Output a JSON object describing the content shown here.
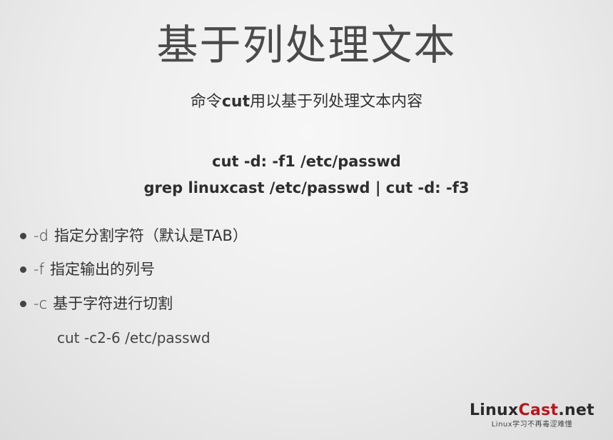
{
  "slide": {
    "title": "基于列处理文本",
    "subtitle": {
      "prefix": "命令",
      "keyword": "cut",
      "suffix": "用以基于列处理文本内容"
    },
    "commands": [
      "cut -d: -f1 /etc/passwd",
      "grep linuxcast /etc/passwd | cut -d: -f3"
    ],
    "bullets": [
      {
        "option": "-d",
        "text": "指定分割字符（默认是TAB）"
      },
      {
        "option": "-f",
        "text": "指定输出的列号"
      },
      {
        "option": "-c",
        "text": "基于字符进行切割"
      }
    ],
    "example": "cut -c2-6 /etc/passwd"
  },
  "logo": {
    "brand_main": "Linux",
    "brand_accent": "Cast",
    "brand_suffix": ".net",
    "tagline": "Linux学习不再毒涩难懂"
  }
}
